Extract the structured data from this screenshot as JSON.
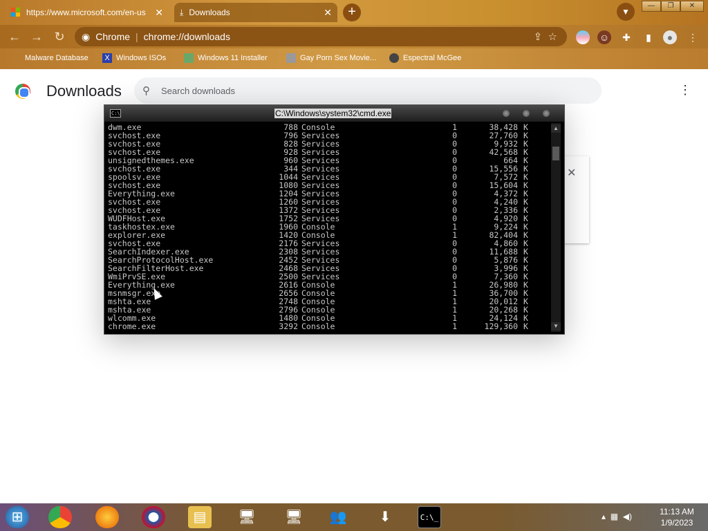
{
  "browser": {
    "tabs": [
      {
        "title": "https://www.microsoft.com/en-us",
        "active": false
      },
      {
        "title": "Downloads",
        "active": true
      }
    ],
    "new_tab_symbol": "+",
    "address": {
      "site_label": "Chrome",
      "url": "chrome://downloads"
    },
    "bookmarks": [
      {
        "label": "Malware Database",
        "icon": "malware-icon"
      },
      {
        "label": "Windows ISOs",
        "icon": "x-icon"
      },
      {
        "label": "Windows 11 Installer",
        "icon": "image-icon"
      },
      {
        "label": "Gay Porn Sex Movie...",
        "icon": "app-icon"
      },
      {
        "label": "Espectral McGee",
        "icon": "avatar-icon"
      }
    ]
  },
  "downloads_page": {
    "title": "Downloads",
    "search_placeholder": "Search downloads"
  },
  "cmd_window": {
    "title": "C:\\Windows\\system32\\cmd.exe",
    "rows": [
      [
        "dwm.exe",
        "788",
        "Console",
        "1",
        "38,428",
        "K"
      ],
      [
        "svchost.exe",
        "796",
        "Services",
        "0",
        "27,760",
        "K"
      ],
      [
        "svchost.exe",
        "828",
        "Services",
        "0",
        "9,932",
        "K"
      ],
      [
        "svchost.exe",
        "928",
        "Services",
        "0",
        "42,568",
        "K"
      ],
      [
        "unsignedthemes.exe",
        "960",
        "Services",
        "0",
        "664",
        "K"
      ],
      [
        "svchost.exe",
        "344",
        "Services",
        "0",
        "15,556",
        "K"
      ],
      [
        "spoolsv.exe",
        "1044",
        "Services",
        "0",
        "7,572",
        "K"
      ],
      [
        "svchost.exe",
        "1080",
        "Services",
        "0",
        "15,604",
        "K"
      ],
      [
        "Everything.exe",
        "1204",
        "Services",
        "0",
        "4,372",
        "K"
      ],
      [
        "svchost.exe",
        "1260",
        "Services",
        "0",
        "4,240",
        "K"
      ],
      [
        "svchost.exe",
        "1372",
        "Services",
        "0",
        "2,336",
        "K"
      ],
      [
        "WUDFHost.exe",
        "1752",
        "Services",
        "0",
        "4,920",
        "K"
      ],
      [
        "taskhostex.exe",
        "1960",
        "Console",
        "1",
        "9,224",
        "K"
      ],
      [
        "explorer.exe",
        "1420",
        "Console",
        "1",
        "82,404",
        "K"
      ],
      [
        "svchost.exe",
        "2176",
        "Services",
        "0",
        "4,860",
        "K"
      ],
      [
        "SearchIndexer.exe",
        "2308",
        "Services",
        "0",
        "11,688",
        "K"
      ],
      [
        "SearchProtocolHost.exe",
        "2452",
        "Services",
        "0",
        "5,876",
        "K"
      ],
      [
        "SearchFilterHost.exe",
        "2468",
        "Services",
        "0",
        "3,996",
        "K"
      ],
      [
        "WmiPrvSE.exe",
        "2500",
        "Services",
        "0",
        "7,360",
        "K"
      ],
      [
        "Everything.exe",
        "2616",
        "Console",
        "1",
        "26,980",
        "K"
      ],
      [
        "msnmsgr.exe",
        "2656",
        "Console",
        "1",
        "36,700",
        "K"
      ],
      [
        "mshta.exe",
        "2748",
        "Console",
        "1",
        "20,012",
        "K"
      ],
      [
        "mshta.exe",
        "2796",
        "Console",
        "1",
        "20,268",
        "K"
      ],
      [
        "wlcomm.exe",
        "1480",
        "Console",
        "1",
        "24,124",
        "K"
      ],
      [
        "chrome.exe",
        "3292",
        "Console",
        "1",
        "129,360",
        "K"
      ]
    ]
  },
  "taskbar": {
    "apps": [
      "start-orb",
      "chrome",
      "firefox",
      "obama-logo",
      "file-explorer",
      "network-setup",
      "network-setup-2",
      "people",
      "device-install",
      "cmd"
    ],
    "clock_time": "11:13 AM",
    "clock_date": "1/9/2023"
  }
}
